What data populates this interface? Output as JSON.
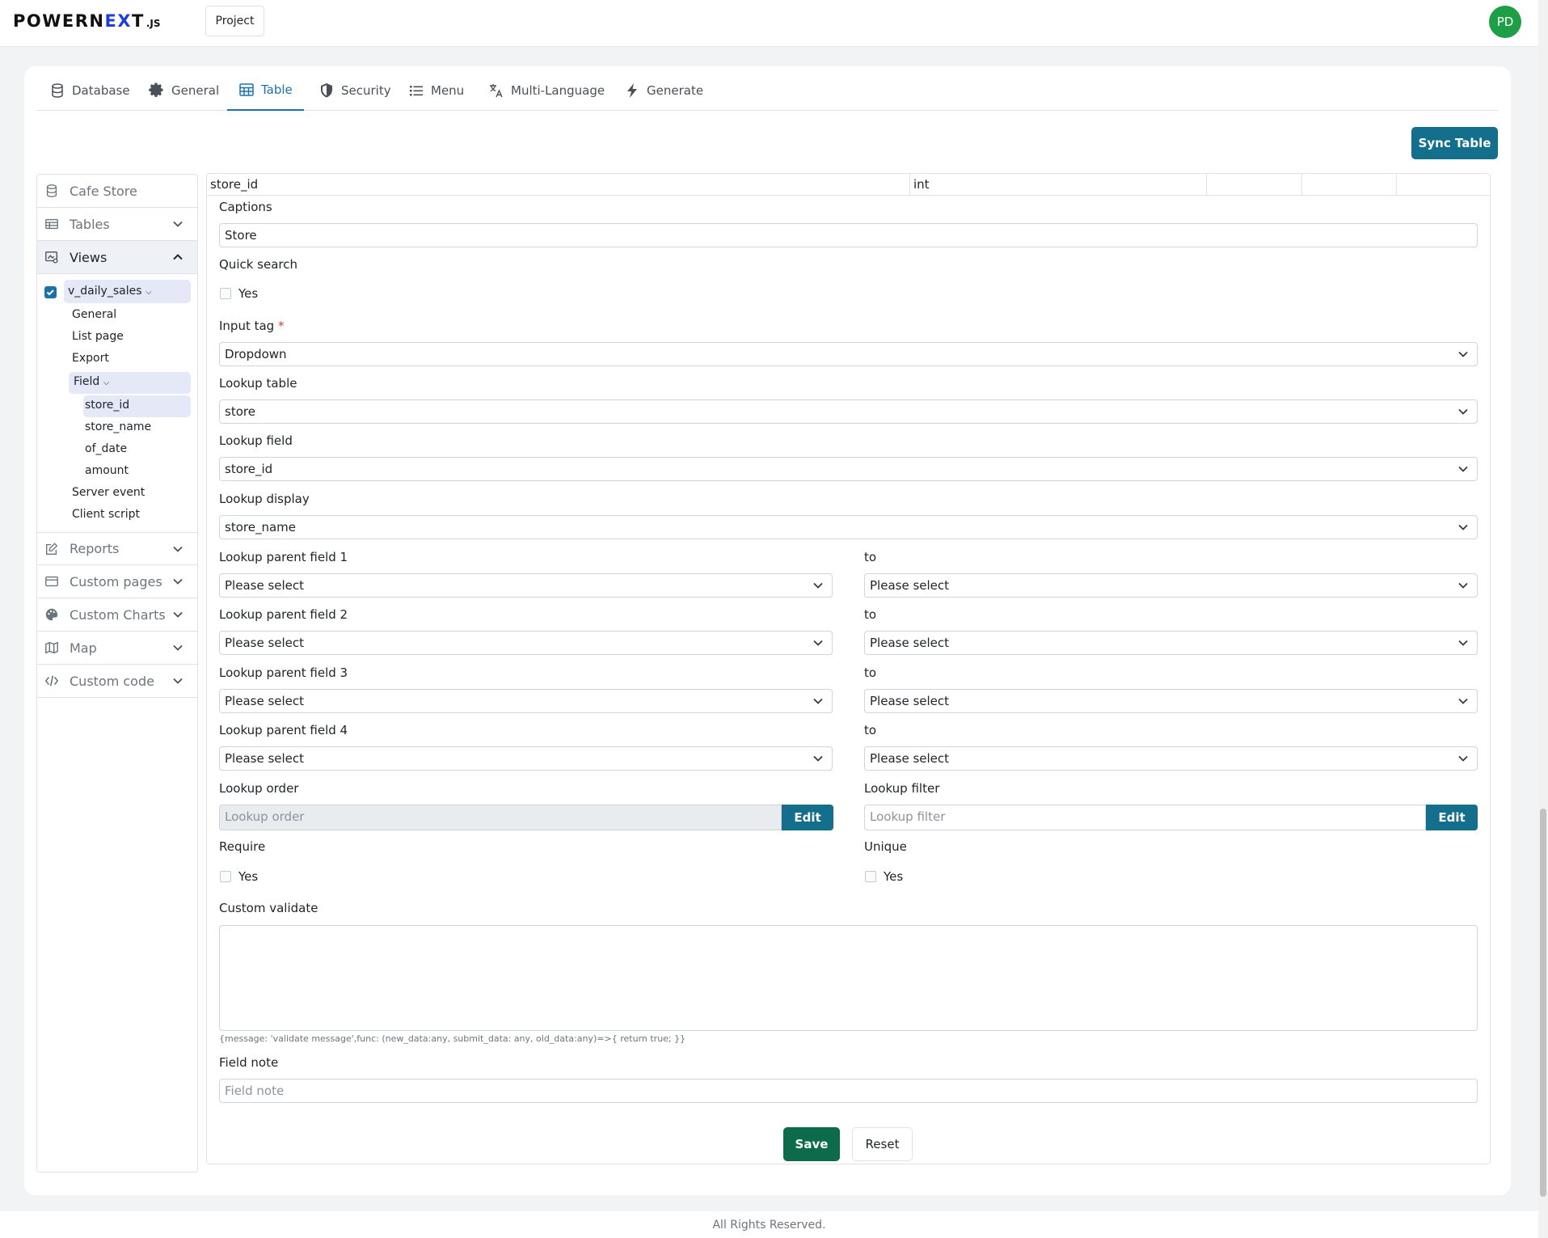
{
  "header": {
    "logo_main": "POWERN",
    "logo_ex": "EX",
    "logo_t": "T",
    "logo_js": ".JS",
    "project_label": "Project",
    "avatar_initials": "PD"
  },
  "tabs": [
    {
      "label": "Database",
      "icon": "database-icon"
    },
    {
      "label": "General",
      "icon": "gear-icon"
    },
    {
      "label": "Table",
      "icon": "table-icon",
      "active": true
    },
    {
      "label": "Security",
      "icon": "shield-icon"
    },
    {
      "label": "Menu",
      "icon": "list-icon"
    },
    {
      "label": "Multi-Language",
      "icon": "translate-icon"
    },
    {
      "label": "Generate",
      "icon": "lightning-icon"
    }
  ],
  "sync_label": "Sync Table",
  "sidebar": {
    "project": "Cafe Store",
    "sections": [
      {
        "label": "Tables",
        "icon": "table-grid-icon"
      },
      {
        "label": "Views",
        "icon": "view-icon",
        "expanded": true
      },
      {
        "label": "Reports",
        "icon": "edit-report-icon"
      },
      {
        "label": "Custom pages",
        "icon": "card-icon"
      },
      {
        "label": "Custom Charts",
        "icon": "palette-icon"
      },
      {
        "label": "Map",
        "icon": "map-icon"
      },
      {
        "label": "Custom code",
        "icon": "code-icon"
      }
    ],
    "view_name": "v_daily_sales",
    "view_items": [
      "General",
      "List page",
      "Export"
    ],
    "field_group": "Field",
    "fields": [
      "store_id",
      "store_name",
      "of_date",
      "amount"
    ],
    "view_items_after": [
      "Server event",
      "Client script"
    ]
  },
  "field_header": {
    "name": "store_id",
    "type": "int"
  },
  "form": {
    "captions_label": "Captions",
    "captions_value": "Store",
    "quick_search_label": "Quick search",
    "yes": "Yes",
    "input_tag_label": "Input tag",
    "required_mark": "*",
    "input_tag_value": "Dropdown",
    "lookup_table_label": "Lookup table",
    "lookup_table_value": "store",
    "lookup_field_label": "Lookup field",
    "lookup_field_value": "store_id",
    "lookup_display_label": "Lookup display",
    "lookup_display_value": "store_name",
    "parent_fields": [
      {
        "label": "Lookup parent field 1",
        "value": "Please select",
        "to_label": "to",
        "to_value": "Please select"
      },
      {
        "label": "Lookup parent field 2",
        "value": "Please select",
        "to_label": "to",
        "to_value": "Please select"
      },
      {
        "label": "Lookup parent field 3",
        "value": "Please select",
        "to_label": "to",
        "to_value": "Please select"
      },
      {
        "label": "Lookup parent field 4",
        "value": "Please select",
        "to_label": "to",
        "to_value": "Please select"
      }
    ],
    "lookup_order_label": "Lookup order",
    "lookup_order_placeholder": "Lookup order",
    "lookup_filter_label": "Lookup filter",
    "lookup_filter_placeholder": "Lookup filter",
    "edit_label": "Edit",
    "require_label": "Require",
    "unique_label": "Unique",
    "custom_validate_label": "Custom validate",
    "custom_validate_hint": "{message: 'validate message',func: (new_data:any, submit_data: any, old_data:any)=>{ return true; }}",
    "field_note_label": "Field note",
    "field_note_placeholder": "Field note",
    "save_label": "Save",
    "reset_label": "Reset"
  },
  "footer": "All Rights Reserved."
}
